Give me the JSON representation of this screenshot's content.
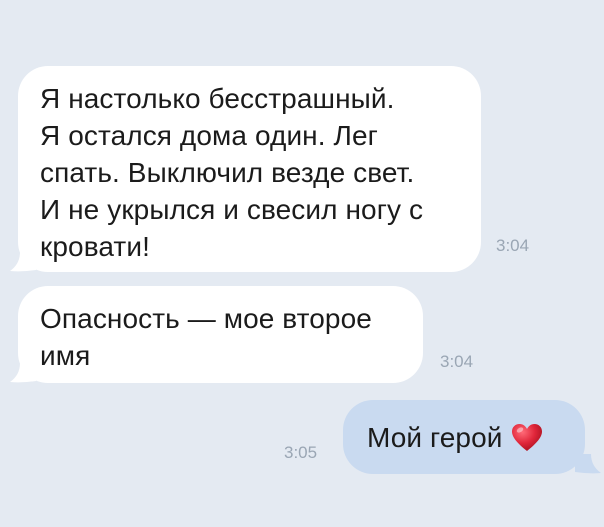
{
  "messages": [
    {
      "direction": "incoming",
      "text": "Я настолько бесстрашный.\nЯ остался дома один. Лег\nспать. Выключил везде свет.\nИ не укрылся и свесил ногу с\nкровати!",
      "time": "3:04"
    },
    {
      "direction": "incoming",
      "text": "Опасность — мое второе\nимя",
      "time": "3:04"
    },
    {
      "direction": "outgoing",
      "text": "Мой герой",
      "emoji": "heart-emoji",
      "time": "3:05"
    }
  ],
  "colors": {
    "background": "#e4eaf2",
    "incoming_bubble": "#ffffff",
    "outgoing_bubble": "#c9daf0",
    "timestamp": "#9aa6b4",
    "heart": "#e0263a"
  }
}
